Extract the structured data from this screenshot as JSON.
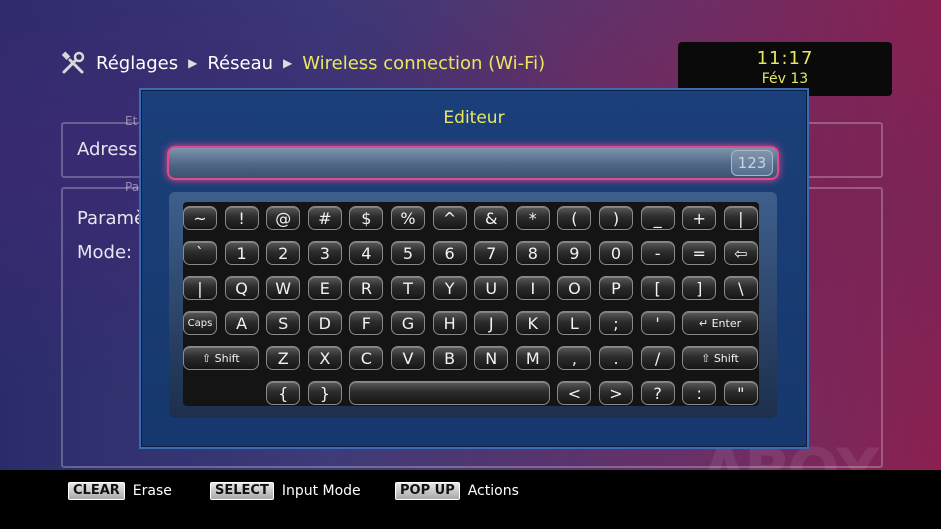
{
  "breadcrumb": {
    "item1": "Réglages",
    "item2": "Réseau",
    "current": "Wireless connection (Wi-Fi)"
  },
  "clock": {
    "time": "11:17",
    "date": "Fév 13"
  },
  "background": {
    "legend1": "Et",
    "legend2": "Pa",
    "label_address": "Adress",
    "label_params": "Paramè",
    "label_mode": "Mode:"
  },
  "editor": {
    "title": "Editeur",
    "input_value": "",
    "mode_label": "123"
  },
  "keyboard": {
    "row1": [
      "~",
      "!",
      "@",
      "#",
      "$",
      "%",
      "^",
      "&",
      "*",
      "(",
      ")",
      "_",
      "+",
      "|"
    ],
    "row2": [
      "`",
      "1",
      "2",
      "3",
      "4",
      "5",
      "6",
      "7",
      "8",
      "9",
      "0",
      "-",
      "=",
      "⇦"
    ],
    "row3": [
      "|",
      "Q",
      "W",
      "E",
      "R",
      "T",
      "Y",
      "U",
      "I",
      "O",
      "P",
      "[",
      "]",
      "\\"
    ],
    "row4_caps": "Caps",
    "row4": [
      "A",
      "S",
      "D",
      "F",
      "G",
      "H",
      "J",
      "K",
      "L",
      ";",
      "'"
    ],
    "enter_label": "Enter",
    "shift_label": "Shift",
    "row5": [
      "Z",
      "X",
      "C",
      "V",
      "B",
      "N",
      "M",
      ",",
      ".",
      "/"
    ],
    "row6_left": [
      "{",
      "}"
    ],
    "row6_right": [
      "<",
      ">",
      "?",
      ":",
      "\""
    ]
  },
  "footer": [
    {
      "key": "CLEAR",
      "label": "Erase"
    },
    {
      "key": "SELECT",
      "label": "Input Mode"
    },
    {
      "key": "POP UP",
      "label": "Actions"
    }
  ],
  "watermark": "ABOX"
}
